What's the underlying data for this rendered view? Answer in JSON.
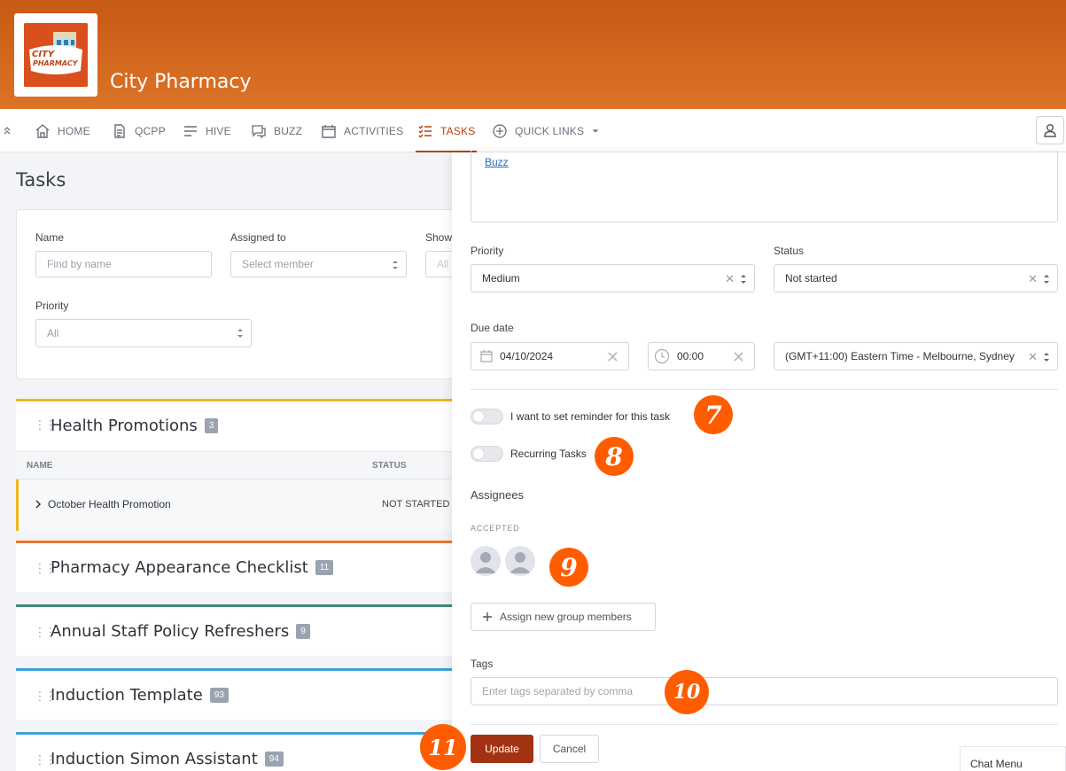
{
  "app": {
    "title": "City Pharmacy",
    "logo_line1": "CITY",
    "logo_line2": "PHARMACY"
  },
  "nav": {
    "items": [
      {
        "label": "HOME",
        "icon": "home-icon"
      },
      {
        "label": "QCPP",
        "icon": "document-icon"
      },
      {
        "label": "HIVE",
        "icon": "lines-icon"
      },
      {
        "label": "BUZZ",
        "icon": "chat-icon"
      },
      {
        "label": "ACTIVITIES",
        "icon": "calendar-icon"
      },
      {
        "label": "TASKS",
        "icon": "tasks-icon",
        "active": true
      },
      {
        "label": "QUICK LINKS",
        "icon": "plus-circle-icon"
      }
    ]
  },
  "page": {
    "title": "Tasks"
  },
  "filters": {
    "name_label": "Name",
    "name_placeholder": "Find by name",
    "assigned_label": "Assigned to",
    "assigned_value": "Select member",
    "show_label": "Show",
    "show_value": "All",
    "priority_label": "Priority",
    "priority_value": "All"
  },
  "groups": [
    {
      "title": "Health Promotions",
      "count": "3",
      "color": "#f3b51f",
      "columns": [
        "NAME",
        "STATUS"
      ],
      "rows": [
        {
          "name": "October Health Promotion",
          "status": "NOT STARTED"
        }
      ]
    },
    {
      "title": "Pharmacy Appearance Checklist",
      "count": "11",
      "color": "#e8772b"
    },
    {
      "title": "Annual Staff Policy Refreshers",
      "count": "9",
      "color": "#3f8a7a"
    },
    {
      "title": "Induction Template",
      "count": "93",
      "color": "#3fa0d8"
    },
    {
      "title": "Induction Simon Assistant",
      "count": "94",
      "color": "#3fa0d8"
    }
  ],
  "form": {
    "buzz_link": "Buzz",
    "priority_label": "Priority",
    "priority_value": "Medium",
    "status_label": "Status",
    "status_value": "Not started",
    "due_label": "Due date",
    "due_date": "04/10/2024",
    "due_time": "00:00",
    "timezone": "(GMT+11:00) Eastern Time - Melbourne, Sydney",
    "reminder_label": "I want to set reminder for this task",
    "recurring_label": "Recurring Tasks",
    "assignees_label": "Assignees",
    "accepted_label": "ACCEPTED",
    "assign_button": "Assign new group members",
    "tags_label": "Tags",
    "tags_placeholder": "Enter tags separated by comma",
    "update_button": "Update",
    "cancel_button": "Cancel"
  },
  "steps": {
    "s7": "7",
    "s8": "8",
    "s9": "9",
    "s10": "10",
    "s11": "11"
  },
  "chat": {
    "label": "Chat Menu"
  },
  "colors": {
    "brand": "#d9691f",
    "accent": "#b8400f",
    "step": "#ff5c00"
  }
}
